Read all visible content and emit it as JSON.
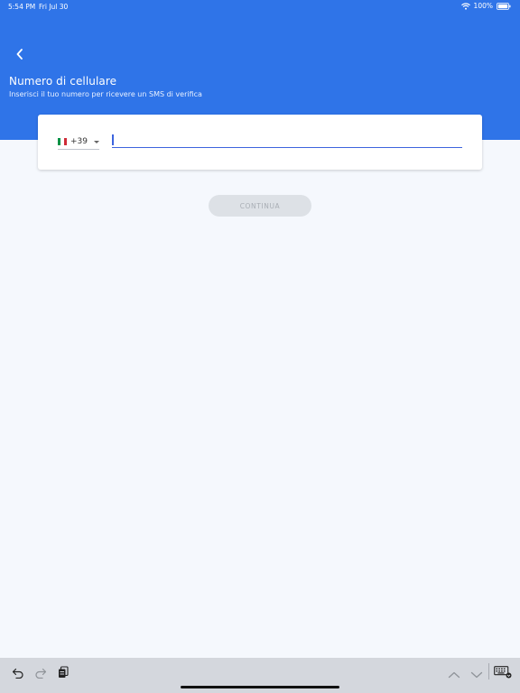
{
  "status_bar": {
    "time": "5:54 PM",
    "date": "Fri Jul 30",
    "battery": "100%"
  },
  "header": {
    "title": "Numero di cellulare",
    "subtitle": "Inserisci il tuo numero per ricevere un SMS di verifica"
  },
  "phone_form": {
    "country_code": "+39",
    "phone_value": "",
    "phone_placeholder": ""
  },
  "actions": {
    "continue_label": "CONTINUA"
  },
  "colors": {
    "header_bg": "#2f74e8",
    "page_bg": "#f5f8fd",
    "input_accent": "#3d64de",
    "button_disabled_bg": "#dde1e6",
    "button_disabled_text": "#a9aeb5",
    "flag_green": "#009246",
    "flag_white": "#ffffff",
    "flag_red": "#ce2b37"
  },
  "icons": {
    "back": "chevron-left-icon",
    "wifi": "wifi-icon",
    "battery": "battery-icon",
    "flag": "italy-flag-icon",
    "dropdown": "caret-down-icon",
    "undo": "undo-icon",
    "redo": "redo-icon",
    "paste": "paste-icon",
    "prev": "chevron-up-icon",
    "next": "chevron-down-icon",
    "keyboard": "keyboard-icon"
  }
}
